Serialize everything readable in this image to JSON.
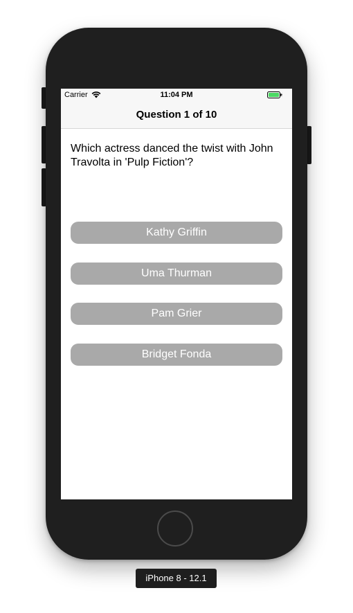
{
  "status_bar": {
    "carrier": "Carrier",
    "time": "11:04 PM",
    "wifi_icon": "wifi-icon",
    "battery_icon": "battery-charging-icon",
    "battery_color": "#4cd964"
  },
  "nav": {
    "title": "Question 1 of 10"
  },
  "question": {
    "text": "Which actress danced the twist with John Travolta in 'Pulp Fiction'?"
  },
  "answers": [
    {
      "label": "Kathy Griffin"
    },
    {
      "label": "Uma Thurman"
    },
    {
      "label": "Pam Grier"
    },
    {
      "label": "Bridget Fonda"
    }
  ],
  "colors": {
    "answer_button_bg": "#a9a9a9",
    "answer_button_text": "#ffffff",
    "phone_body": "#1f1f1f"
  },
  "device": {
    "label": "iPhone 8 - 12.1"
  }
}
